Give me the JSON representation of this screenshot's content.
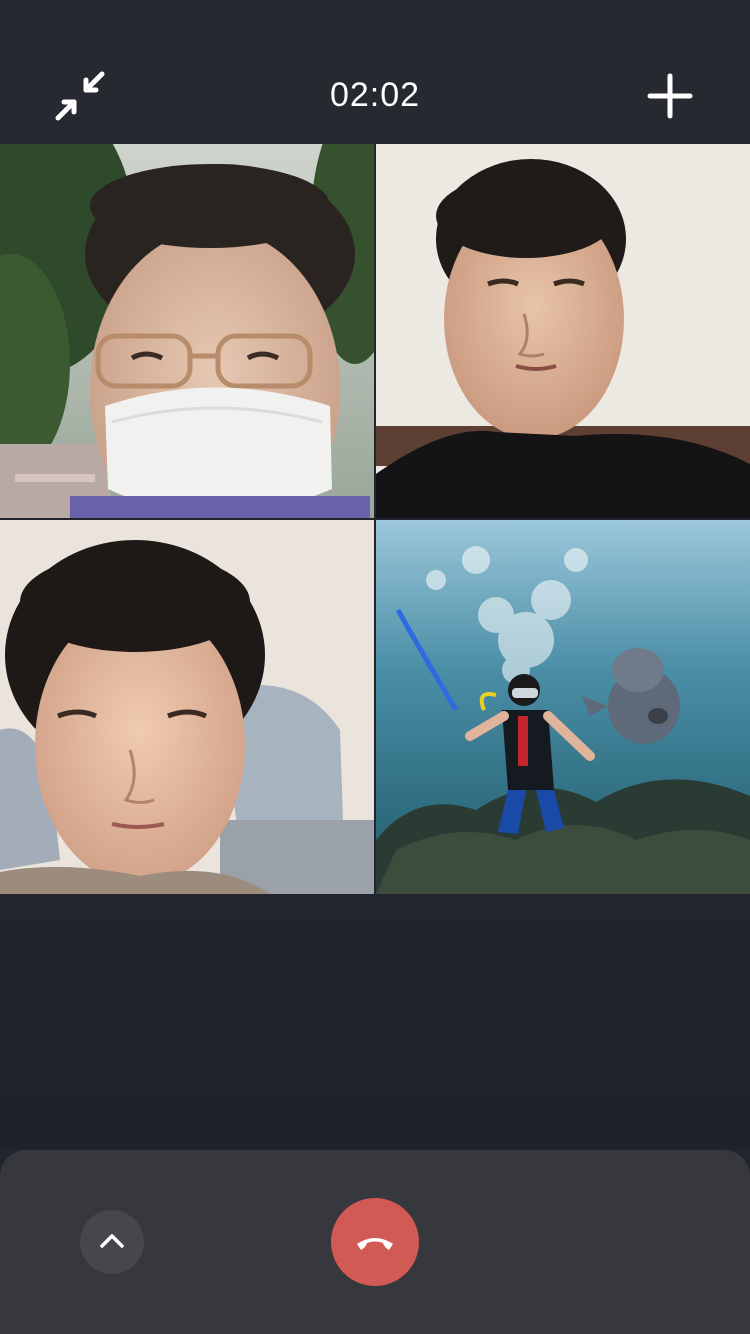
{
  "call": {
    "duration": "02:02"
  },
  "icons": {
    "minimize": "minimize-window-icon",
    "add_participant": "plus-icon",
    "expand": "chevron-up-icon",
    "hangup": "phone-hangup-icon"
  },
  "participants": [
    {
      "id": "participant-1",
      "video": "man-with-glasses-and-mask-outdoors"
    },
    {
      "id": "participant-2",
      "video": "woman-black-shirt-white-wall"
    },
    {
      "id": "participant-3",
      "video": "woman-gray-headrest"
    },
    {
      "id": "participant-4",
      "video": "diver-with-fish-underwater"
    }
  ],
  "colors": {
    "background": "#22252d",
    "topbar": "#262930",
    "bottom_sheet": "#36383d",
    "hangup_red": "#d25a55"
  }
}
